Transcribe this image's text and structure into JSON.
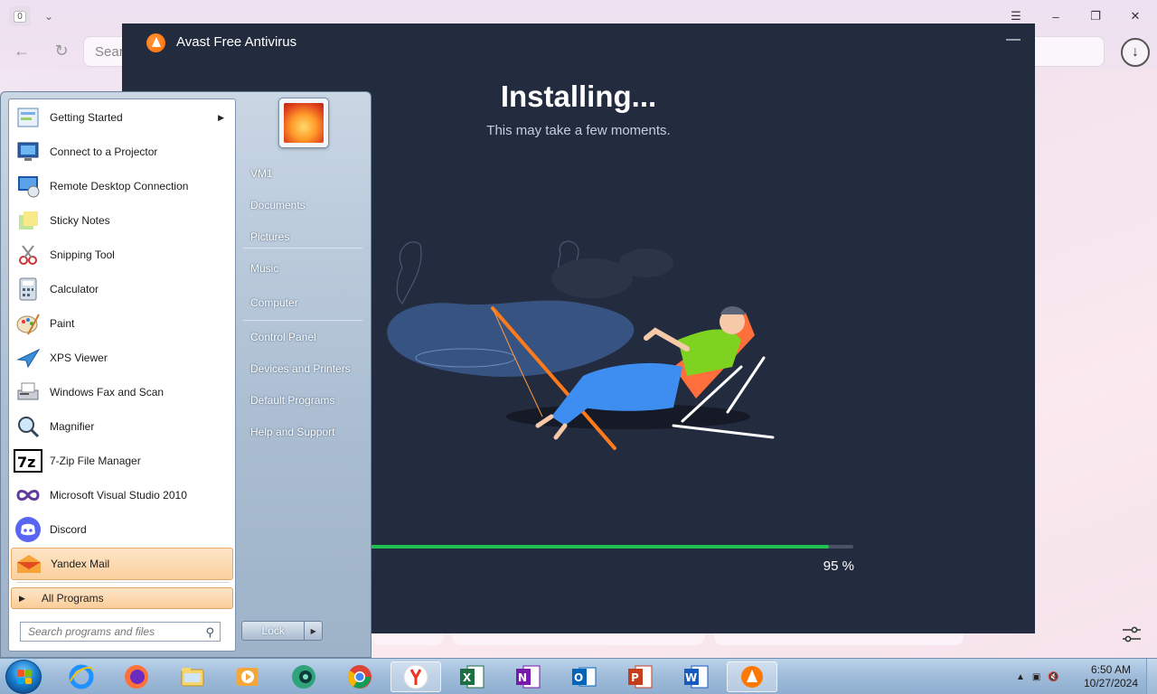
{
  "browser": {
    "tab_count": "0",
    "address_placeholder": "Sear"
  },
  "avast": {
    "title": "Avast Free Antivirus",
    "heading": "Installing...",
    "subtitle": "This may take a few moments.",
    "progress_percent": 95,
    "progress_label": "95 %",
    "accent": "#1fbf51",
    "background": "#232b3f"
  },
  "start_menu": {
    "programs": [
      {
        "label": "Getting Started",
        "icon": "getting-started-icon",
        "submenu": true
      },
      {
        "label": "Connect to a Projector",
        "icon": "projector-icon"
      },
      {
        "label": "Remote Desktop Connection",
        "icon": "remote-desktop-icon"
      },
      {
        "label": "Sticky Notes",
        "icon": "sticky-notes-icon"
      },
      {
        "label": "Snipping Tool",
        "icon": "snipping-tool-icon"
      },
      {
        "label": "Calculator",
        "icon": "calculator-icon"
      },
      {
        "label": "Paint",
        "icon": "paint-icon"
      },
      {
        "label": "XPS Viewer",
        "icon": "xps-viewer-icon"
      },
      {
        "label": "Windows Fax and Scan",
        "icon": "fax-scan-icon"
      },
      {
        "label": "Magnifier",
        "icon": "magnifier-icon"
      },
      {
        "label": "7-Zip File Manager",
        "icon": "7zip-icon"
      },
      {
        "label": "Microsoft Visual Studio 2010",
        "icon": "visual-studio-icon"
      },
      {
        "label": "Discord",
        "icon": "discord-icon"
      },
      {
        "label": "Yandex Mail",
        "icon": "yandex-mail-icon",
        "highlight": true
      }
    ],
    "all_programs": "All Programs",
    "search_placeholder": "Search programs and files",
    "right_items": [
      {
        "label": "VM1"
      },
      {
        "label": "Documents"
      },
      {
        "label": "Pictures"
      },
      {
        "label": "Music"
      },
      {
        "label": "Computer"
      },
      {
        "label": "Control Panel"
      },
      {
        "label": "Devices and Printers"
      },
      {
        "label": "Default Programs"
      },
      {
        "label": "Help and Support"
      }
    ],
    "lock_label": "Lock"
  },
  "taskbar": {
    "apps": [
      {
        "name": "internet-explorer-icon"
      },
      {
        "name": "firefox-icon"
      },
      {
        "name": "file-explorer-icon"
      },
      {
        "name": "media-player-icon"
      },
      {
        "name": "webcam-app-icon"
      },
      {
        "name": "chrome-icon"
      },
      {
        "name": "yandex-browser-icon",
        "active": true
      },
      {
        "name": "excel-icon"
      },
      {
        "name": "onenote-icon"
      },
      {
        "name": "outlook-icon"
      },
      {
        "name": "powerpoint-icon"
      },
      {
        "name": "word-icon"
      },
      {
        "name": "avast-icon",
        "active": true
      }
    ],
    "time": "6:50 AM",
    "date": "10/27/2024"
  }
}
